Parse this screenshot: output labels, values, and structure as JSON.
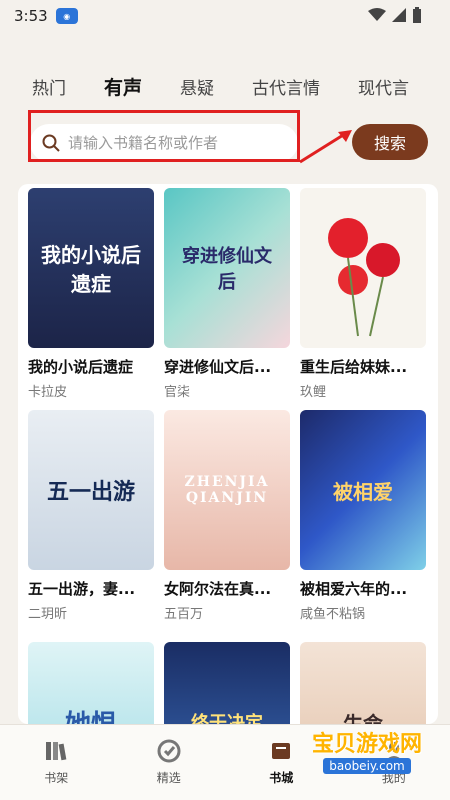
{
  "status": {
    "time": "3:53"
  },
  "tabs": [
    {
      "label": "热门"
    },
    {
      "label": "有声"
    },
    {
      "label": "悬疑"
    },
    {
      "label": "古代言情"
    },
    {
      "label": "现代言"
    }
  ],
  "search": {
    "placeholder": "请输入书籍名称或作者",
    "button": "搜索"
  },
  "books": [
    {
      "title": "我的小说后遗症",
      "author": "卡拉皮",
      "cover_text": "我的小说后遗症"
    },
    {
      "title": "穿进修仙文后...",
      "author": "官柒",
      "cover_text": "穿进修仙文后"
    },
    {
      "title": "重生后给妹妹...",
      "author": "玖鲤",
      "cover_text": ""
    },
    {
      "title": "五一出游，妻...",
      "author": "二玥昕",
      "cover_text": "五一出游"
    },
    {
      "title": "女阿尔法在真...",
      "author": "五百万",
      "cover_text": "ZHENJIA QIANJIN"
    },
    {
      "title": "被相爱六年的...",
      "author": "咸鱼不粘锅",
      "cover_text": "被相爱"
    },
    {
      "title": "",
      "author": "",
      "cover_text": "她恨"
    },
    {
      "title": "",
      "author": "",
      "cover_text": "终于决定"
    },
    {
      "title": "",
      "author": "",
      "cover_text": "生命"
    }
  ],
  "nav": [
    {
      "label": "书架",
      "icon": "bookshelf-icon"
    },
    {
      "label": "精选",
      "icon": "featured-icon"
    },
    {
      "label": "书城",
      "icon": "bookstore-icon"
    },
    {
      "label": "我的",
      "icon": "profile-icon"
    }
  ],
  "watermark": {
    "text": "宝贝游戏网",
    "url": "baobeiy.com"
  },
  "colors": {
    "accent": "#7b3a1e",
    "highlight": "#e02020"
  }
}
